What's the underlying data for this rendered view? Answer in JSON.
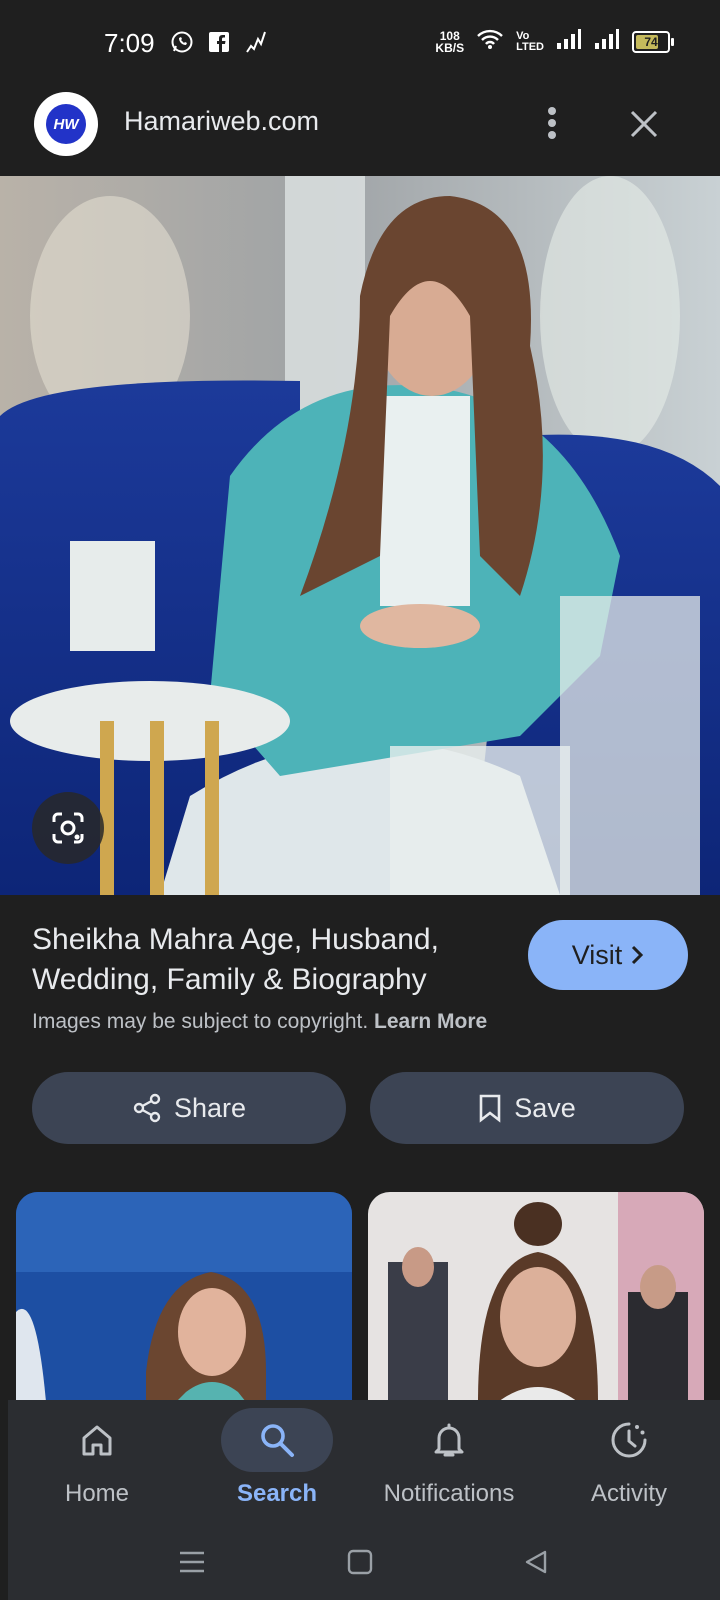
{
  "status_bar": {
    "time": "7:09",
    "net_speed_value": "108",
    "net_speed_unit": "KB/S",
    "volte_top": "Vo",
    "volte_bottom": "LTED",
    "battery_level": "74",
    "battery_fraction": 0.74,
    "left_icons": [
      "whatsapp-icon",
      "facebook-icon",
      "signal-activity-icon"
    ],
    "right_icons": [
      "wifi-icon",
      "signal-bars-icon",
      "signal-bars-icon",
      "battery-icon"
    ]
  },
  "top_bar": {
    "logo_text": "HW",
    "site_name": "Hamariweb.com",
    "icons": [
      "more-vert-icon",
      "close-icon"
    ]
  },
  "hero": {
    "lens_icon": "google-lens-icon"
  },
  "result": {
    "title": "Sheikha Mahra Age, Husband, Wedding, Family & Biography",
    "visit_label": "Visit",
    "copyright_text": "Images may be subject to copyright.",
    "learn_more": "Learn More"
  },
  "actions": {
    "share_label": "Share",
    "save_label": "Save"
  },
  "bottom_nav": {
    "items": [
      {
        "label": "Home",
        "icon": "home-icon"
      },
      {
        "label": "Search",
        "icon": "search-icon",
        "active": true
      },
      {
        "label": "Notifications",
        "icon": "bell-icon"
      },
      {
        "label": "Activity",
        "icon": "activity-icon"
      }
    ]
  },
  "colors": {
    "background": "#1f1f1f",
    "accent": "#8ab4f8",
    "pill": "#3c4454",
    "nav_bg": "#2b2d31"
  }
}
